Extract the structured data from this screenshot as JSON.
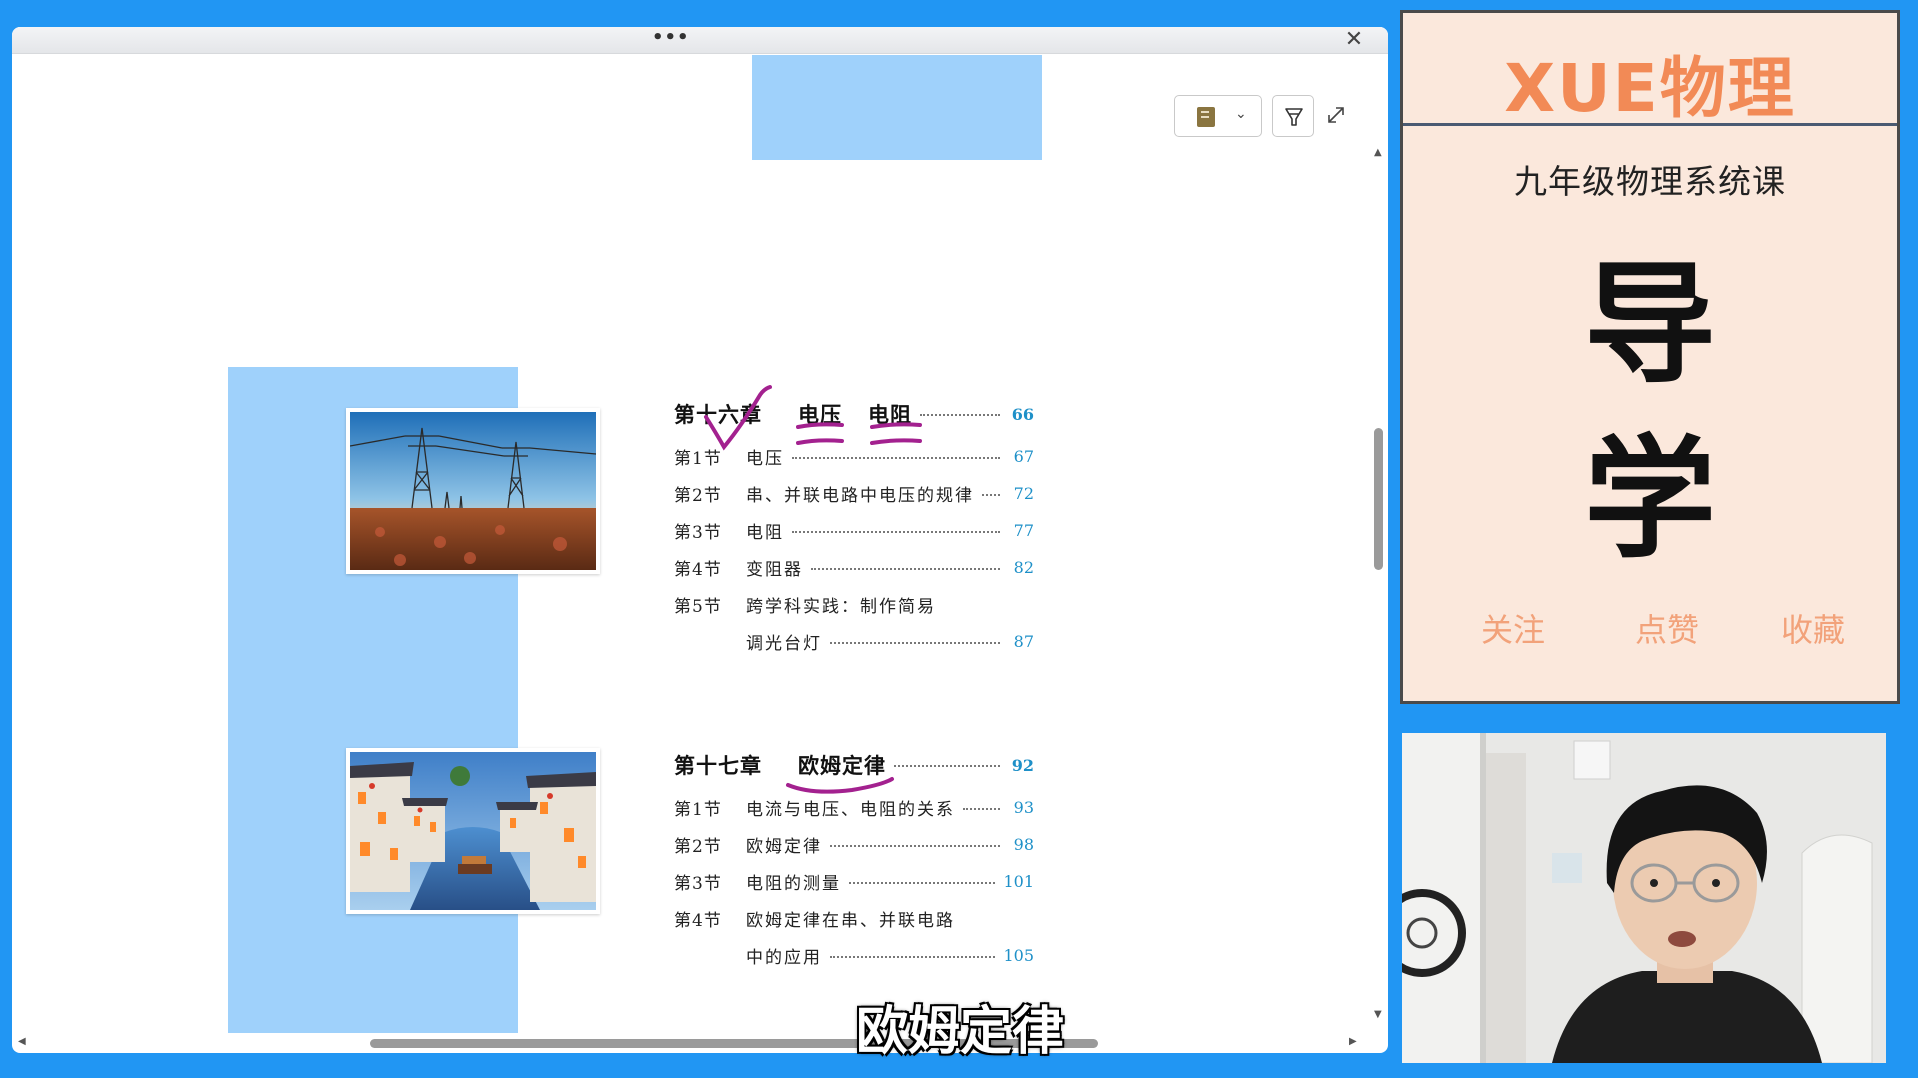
{
  "viewer": {
    "more_glyph": "•••",
    "close_glyph": "✕",
    "toolbar": {
      "notebook_icon": "notebook-icon",
      "chevron_glyph": "⌄",
      "highlighter_icon": "highlighter-icon",
      "expand_icon": "expand-icon"
    },
    "scroll_glyphs": {
      "up": "▲",
      "down": "▼",
      "left": "◀",
      "right": "▶"
    },
    "toc": {
      "chapter16": {
        "num": "第十六章",
        "title_a": "电压",
        "title_b": "电阻",
        "page": "66",
        "sections": [
          {
            "num": "第1节",
            "title": "电压",
            "page": "67"
          },
          {
            "num": "第2节",
            "title": "串、并联电路中电压的规律",
            "page": "72"
          },
          {
            "num": "第3节",
            "title": "电阻",
            "page": "77"
          },
          {
            "num": "第4节",
            "title": "变阻器",
            "page": "82"
          }
        ],
        "section5_num": "第5节",
        "section5_title_line1": "跨学科实践：制作简易",
        "section5_title_line2": "调光台灯",
        "section5_page": "87"
      },
      "chapter17": {
        "num": "第十七章",
        "title": "欧姆定律",
        "page": "92",
        "sections": [
          {
            "num": "第1节",
            "title": "电流与电压、电阻的关系",
            "page": "93"
          },
          {
            "num": "第2节",
            "title": "欧姆定律",
            "page": "98"
          },
          {
            "num": "第3节",
            "title": "电阻的测量",
            "page": "101"
          }
        ],
        "section4_num": "第4节",
        "section4_title_line1": "欧姆定律在串、并联电路",
        "section4_title_line2": "中的应用",
        "section4_page": "105"
      }
    },
    "annotation_color": "#a3218f",
    "accent_blue": "#9fd1fb"
  },
  "subtitle": "欧姆定律",
  "card": {
    "brand": "XUE物理",
    "course": "九年级物理系统课",
    "char1": "导",
    "char2": "学",
    "actions": {
      "follow": "关注",
      "like": "点赞",
      "collect": "收藏"
    },
    "brand_color": "#f28a56",
    "background": "#fbe8dc"
  }
}
